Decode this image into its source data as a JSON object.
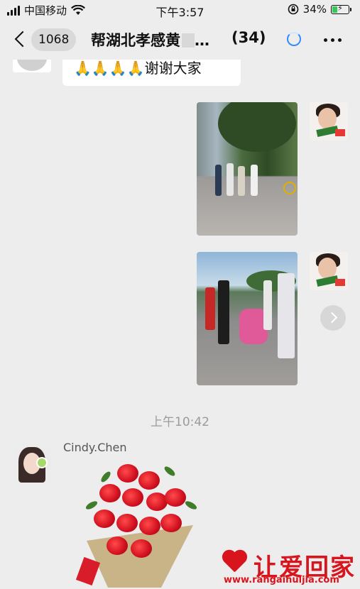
{
  "status_bar": {
    "carrier": "中国移动",
    "time": "下午3:57",
    "battery_percent": "34%",
    "battery_level": 0.34,
    "icons": [
      "signal-icon",
      "wifi-icon",
      "rotation-lock-icon",
      "battery-charging-icon"
    ]
  },
  "nav": {
    "back_count": "1068",
    "title": "帮湖北孝感黄",
    "ellipsis": "…",
    "member_count": "(34)",
    "icons": [
      "back-chevron-icon",
      "loading-icon",
      "more-icon"
    ]
  },
  "messages": {
    "top_bubble_text": "🙏🙏🙏🙏谢谢大家",
    "timestamp": "上午10:42",
    "sender_name": "Cindy.Chen"
  },
  "watermark": {
    "brand": "让爱回家",
    "url": "www.rangaihuijia.com"
  },
  "colors": {
    "background": "#ededed",
    "accent_blue": "#2f8cff",
    "brand_red": "#d8141d",
    "battery_green": "#34c759"
  }
}
